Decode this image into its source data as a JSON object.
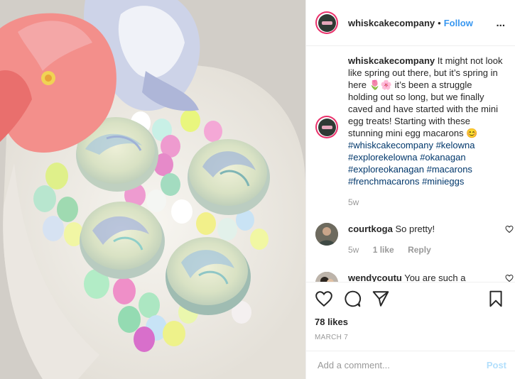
{
  "header": {
    "username": "whiskcakecompany",
    "separator": "•",
    "follow_label": "Follow",
    "more_label": "..."
  },
  "caption": {
    "username": "whiskcakecompany",
    "text_a": " It might not look like spring out there, but it’s spring in here ",
    "emoji_a": "🌷🌸",
    "text_b": " it’s been a struggle holding out so long, but we finally caved and have started with the mini egg treats! Starting with these stunning mini egg macarons ",
    "emoji_b": "😊",
    "hashtags": [
      "#whiskcakecompany",
      "#kelowna",
      "#explorekelowna",
      "#okanagan",
      "#exploreokanagan",
      "#macarons",
      "#frenchmacarons",
      "#minieggs"
    ],
    "time": "5w"
  },
  "comments": [
    {
      "username": "courtkoga",
      "text": " So pretty!",
      "time": "5w",
      "likes": "1 like",
      "reply": "Reply"
    },
    {
      "username": "wendycoutu",
      "text": " You are such a Amazing Artist!"
    }
  ],
  "actions": {
    "likes": "78 likes",
    "date": "MARCH 7"
  },
  "add_comment": {
    "placeholder": "Add a comment...",
    "post_label": "Post"
  },
  "colors": {
    "link": "#3897f0",
    "hashtag": "#00376b",
    "muted": "#999999",
    "post_disabled": "#b2dffc"
  }
}
